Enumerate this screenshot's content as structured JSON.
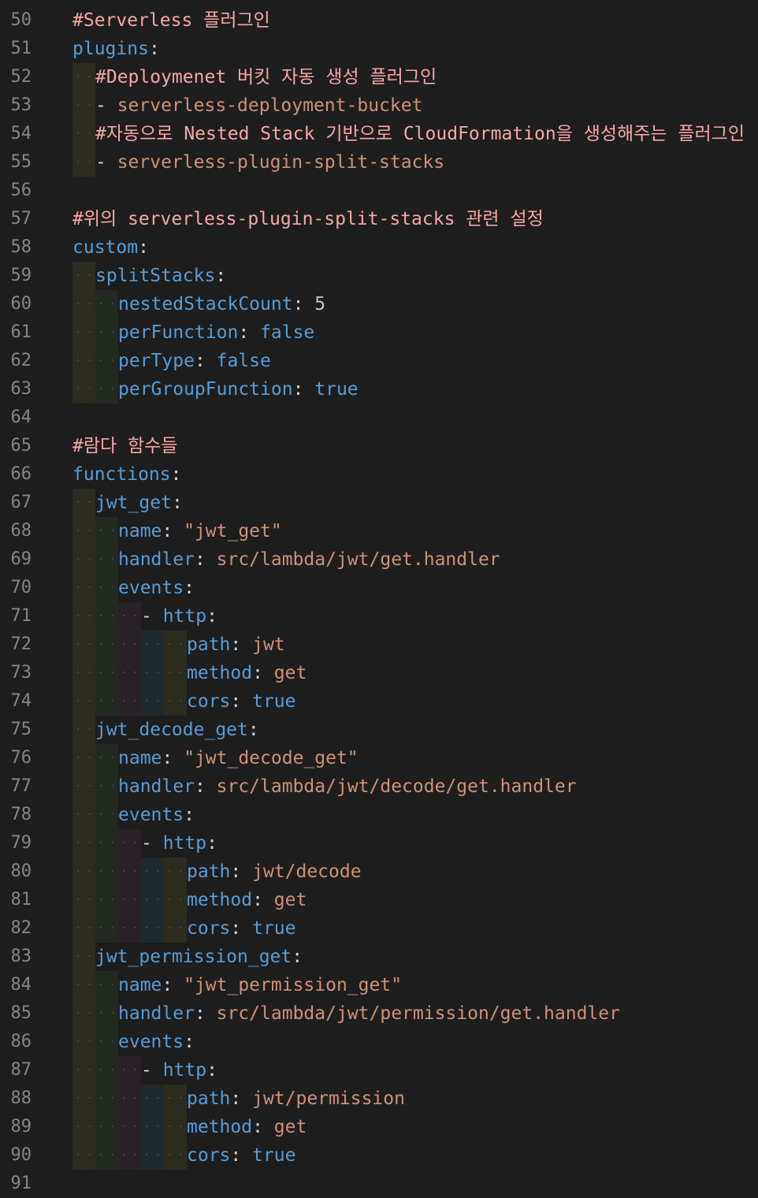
{
  "editor": {
    "language": "yaml",
    "colors": {
      "background": "#1e1e1e",
      "line_number": "#858585",
      "comment": "#f7a6a6",
      "key": "#569cd6",
      "string": "#ce9178",
      "number": "#b5cea8",
      "boolean": "#569cd6"
    },
    "lines": [
      {
        "no": "50",
        "indent": 0,
        "parts": [
          {
            "t": "comment",
            "v": "#Serverless 플러그인"
          }
        ]
      },
      {
        "no": "51",
        "indent": 0,
        "parts": [
          {
            "t": "key",
            "v": "plugins"
          },
          {
            "t": "colon",
            "v": ":"
          }
        ]
      },
      {
        "no": "52",
        "indent": 1,
        "parts": [
          {
            "t": "comment",
            "v": "#Deploymenet 버킷 자동 생성 플러그인"
          }
        ]
      },
      {
        "no": "53",
        "indent": 1,
        "parts": [
          {
            "t": "dash",
            "v": "- "
          },
          {
            "t": "str",
            "v": "serverless-deployment-bucket"
          }
        ]
      },
      {
        "no": "54",
        "indent": 1,
        "parts": [
          {
            "t": "comment",
            "v": "#자동으로 Nested Stack 기반으로 CloudFormation을 생성해주는 플러그인"
          }
        ]
      },
      {
        "no": "55",
        "indent": 1,
        "parts": [
          {
            "t": "dash",
            "v": "- "
          },
          {
            "t": "str",
            "v": "serverless-plugin-split-stacks"
          }
        ]
      },
      {
        "no": "56",
        "indent": 0,
        "parts": []
      },
      {
        "no": "57",
        "indent": 0,
        "parts": [
          {
            "t": "comment",
            "v": "#위의 serverless-plugin-split-stacks 관련 설정"
          }
        ]
      },
      {
        "no": "58",
        "indent": 0,
        "parts": [
          {
            "t": "key",
            "v": "custom"
          },
          {
            "t": "colon",
            "v": ":"
          }
        ]
      },
      {
        "no": "59",
        "indent": 1,
        "parts": [
          {
            "t": "key",
            "v": "splitStacks"
          },
          {
            "t": "colon",
            "v": ":"
          }
        ]
      },
      {
        "no": "60",
        "indent": 2,
        "parts": [
          {
            "t": "key",
            "v": "nestedStackCount"
          },
          {
            "t": "colon",
            "v": ": "
          },
          {
            "t": "num",
            "v": "5"
          }
        ]
      },
      {
        "no": "61",
        "indent": 2,
        "parts": [
          {
            "t": "key",
            "v": "perFunction"
          },
          {
            "t": "colon",
            "v": ": "
          },
          {
            "t": "bool",
            "v": "false"
          }
        ]
      },
      {
        "no": "62",
        "indent": 2,
        "parts": [
          {
            "t": "key",
            "v": "perType"
          },
          {
            "t": "colon",
            "v": ": "
          },
          {
            "t": "bool",
            "v": "false"
          }
        ]
      },
      {
        "no": "63",
        "indent": 2,
        "parts": [
          {
            "t": "key",
            "v": "perGroupFunction"
          },
          {
            "t": "colon",
            "v": ": "
          },
          {
            "t": "bool",
            "v": "true"
          }
        ]
      },
      {
        "no": "64",
        "indent": 0,
        "parts": []
      },
      {
        "no": "65",
        "indent": 0,
        "parts": [
          {
            "t": "comment",
            "v": "#람다 함수들"
          }
        ]
      },
      {
        "no": "66",
        "indent": 0,
        "parts": [
          {
            "t": "key",
            "v": "functions"
          },
          {
            "t": "colon",
            "v": ":"
          }
        ]
      },
      {
        "no": "67",
        "indent": 1,
        "parts": [
          {
            "t": "key",
            "v": "jwt_get"
          },
          {
            "t": "colon",
            "v": ":"
          }
        ]
      },
      {
        "no": "68",
        "indent": 2,
        "parts": [
          {
            "t": "key",
            "v": "name"
          },
          {
            "t": "colon",
            "v": ": "
          },
          {
            "t": "str",
            "v": "\"jwt_get\""
          }
        ]
      },
      {
        "no": "69",
        "indent": 2,
        "parts": [
          {
            "t": "key",
            "v": "handler"
          },
          {
            "t": "colon",
            "v": ": "
          },
          {
            "t": "str",
            "v": "src/lambda/jwt/get.handler"
          }
        ]
      },
      {
        "no": "70",
        "indent": 2,
        "parts": [
          {
            "t": "key",
            "v": "events"
          },
          {
            "t": "colon",
            "v": ":"
          }
        ]
      },
      {
        "no": "71",
        "indent": 3,
        "parts": [
          {
            "t": "dash",
            "v": "- "
          },
          {
            "t": "key",
            "v": "http"
          },
          {
            "t": "colon",
            "v": ":"
          }
        ]
      },
      {
        "no": "72",
        "indent": 5,
        "parts": [
          {
            "t": "key",
            "v": "path"
          },
          {
            "t": "colon",
            "v": ": "
          },
          {
            "t": "str",
            "v": "jwt"
          }
        ]
      },
      {
        "no": "73",
        "indent": 5,
        "parts": [
          {
            "t": "key",
            "v": "method"
          },
          {
            "t": "colon",
            "v": ": "
          },
          {
            "t": "str",
            "v": "get"
          }
        ]
      },
      {
        "no": "74",
        "indent": 5,
        "parts": [
          {
            "t": "key",
            "v": "cors"
          },
          {
            "t": "colon",
            "v": ": "
          },
          {
            "t": "bool",
            "v": "true"
          }
        ]
      },
      {
        "no": "75",
        "indent": 1,
        "parts": [
          {
            "t": "key",
            "v": "jwt_decode_get"
          },
          {
            "t": "colon",
            "v": ":"
          }
        ]
      },
      {
        "no": "76",
        "indent": 2,
        "parts": [
          {
            "t": "key",
            "v": "name"
          },
          {
            "t": "colon",
            "v": ": "
          },
          {
            "t": "str",
            "v": "\"jwt_decode_get\""
          }
        ]
      },
      {
        "no": "77",
        "indent": 2,
        "parts": [
          {
            "t": "key",
            "v": "handler"
          },
          {
            "t": "colon",
            "v": ": "
          },
          {
            "t": "str",
            "v": "src/lambda/jwt/decode/get.handler"
          }
        ]
      },
      {
        "no": "78",
        "indent": 2,
        "parts": [
          {
            "t": "key",
            "v": "events"
          },
          {
            "t": "colon",
            "v": ":"
          }
        ]
      },
      {
        "no": "79",
        "indent": 3,
        "parts": [
          {
            "t": "dash",
            "v": "- "
          },
          {
            "t": "key",
            "v": "http"
          },
          {
            "t": "colon",
            "v": ":"
          }
        ]
      },
      {
        "no": "80",
        "indent": 5,
        "parts": [
          {
            "t": "key",
            "v": "path"
          },
          {
            "t": "colon",
            "v": ": "
          },
          {
            "t": "str",
            "v": "jwt/decode"
          }
        ]
      },
      {
        "no": "81",
        "indent": 5,
        "parts": [
          {
            "t": "key",
            "v": "method"
          },
          {
            "t": "colon",
            "v": ": "
          },
          {
            "t": "str",
            "v": "get"
          }
        ]
      },
      {
        "no": "82",
        "indent": 5,
        "parts": [
          {
            "t": "key",
            "v": "cors"
          },
          {
            "t": "colon",
            "v": ": "
          },
          {
            "t": "bool",
            "v": "true"
          }
        ]
      },
      {
        "no": "83",
        "indent": 1,
        "parts": [
          {
            "t": "key",
            "v": "jwt_permission_get"
          },
          {
            "t": "colon",
            "v": ":"
          }
        ]
      },
      {
        "no": "84",
        "indent": 2,
        "parts": [
          {
            "t": "key",
            "v": "name"
          },
          {
            "t": "colon",
            "v": ": "
          },
          {
            "t": "str",
            "v": "\"jwt_permission_get\""
          }
        ]
      },
      {
        "no": "85",
        "indent": 2,
        "parts": [
          {
            "t": "key",
            "v": "handler"
          },
          {
            "t": "colon",
            "v": ": "
          },
          {
            "t": "str",
            "v": "src/lambda/jwt/permission/get.handler"
          }
        ]
      },
      {
        "no": "86",
        "indent": 2,
        "parts": [
          {
            "t": "key",
            "v": "events"
          },
          {
            "t": "colon",
            "v": ":"
          }
        ]
      },
      {
        "no": "87",
        "indent": 3,
        "parts": [
          {
            "t": "dash",
            "v": "- "
          },
          {
            "t": "key",
            "v": "http"
          },
          {
            "t": "colon",
            "v": ":"
          }
        ]
      },
      {
        "no": "88",
        "indent": 5,
        "parts": [
          {
            "t": "key",
            "v": "path"
          },
          {
            "t": "colon",
            "v": ": "
          },
          {
            "t": "str",
            "v": "jwt/permission"
          }
        ]
      },
      {
        "no": "89",
        "indent": 5,
        "parts": [
          {
            "t": "key",
            "v": "method"
          },
          {
            "t": "colon",
            "v": ": "
          },
          {
            "t": "str",
            "v": "get"
          }
        ]
      },
      {
        "no": "90",
        "indent": 5,
        "parts": [
          {
            "t": "key",
            "v": "cors"
          },
          {
            "t": "colon",
            "v": ": "
          },
          {
            "t": "bool",
            "v": "true"
          }
        ]
      },
      {
        "no": "91",
        "indent": 0,
        "parts": []
      }
    ]
  }
}
